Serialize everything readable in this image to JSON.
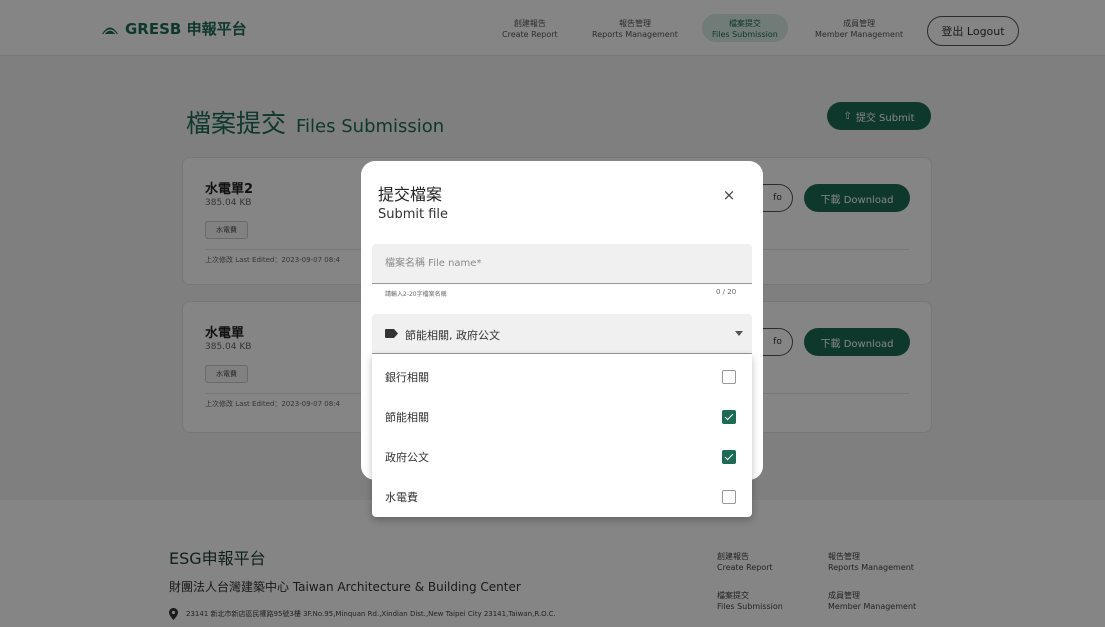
{
  "header": {
    "logo_text": "GRESB 申報平台",
    "nav": [
      {
        "zh": "創建報告",
        "en": "Create Report"
      },
      {
        "zh": "報告管理",
        "en": "Reports Management"
      },
      {
        "zh": "檔案提交",
        "en": "Files Submission"
      },
      {
        "zh": "成員管理",
        "en": "Member Management"
      }
    ],
    "logout": "登出 Logout"
  },
  "page": {
    "title_zh": "檔案提交",
    "title_en": "Files Submission",
    "submit_button": "提交 Submit"
  },
  "cards": [
    {
      "title": "水電單2",
      "size": "385.04 KB",
      "tag": "水電費",
      "edited": "上次修改 Last Edited：2023-09-07 08:4",
      "info_label": "fo",
      "download_label": "下載 Download"
    },
    {
      "title": "水電單",
      "size": "385.04 KB",
      "tag": "水電費",
      "edited": "上次修改 Last Edited：2023-09-07 08:4",
      "info_label": "fo",
      "download_label": "下載 Download"
    }
  ],
  "footer": {
    "title": "ESG申報平台",
    "org": "財團法人台灣建築中心 Taiwan Architecture & Building Center",
    "address": "23141 新北市新店區民權路95號3樓 3F.No.95,Minquan Rd.,Xindian Dist.,New Taipei City 23141,Taiwan,R.O.C.",
    "links": [
      {
        "zh": "創建報告",
        "en": "Create Report"
      },
      {
        "zh": "報告管理",
        "en": "Reports Management"
      },
      {
        "zh": "檔案提交",
        "en": "Files Submission"
      },
      {
        "zh": "成員管理",
        "en": "Member Management"
      }
    ]
  },
  "modal": {
    "title_zh": "提交檔案",
    "title_en": "Submit file",
    "close": "×",
    "file_name_placeholder": "檔案名稱 File name*",
    "helper": "請輸入2-20字檔案名稱",
    "counter": "0 / 20",
    "select_value": "節能相關, 政府公文",
    "options": [
      {
        "label": "銀行相關",
        "checked": false
      },
      {
        "label": "節能相關",
        "checked": true
      },
      {
        "label": "政府公文",
        "checked": true
      },
      {
        "label": "水電費",
        "checked": false
      }
    ]
  },
  "colors": {
    "brand": "#1d6b55"
  }
}
